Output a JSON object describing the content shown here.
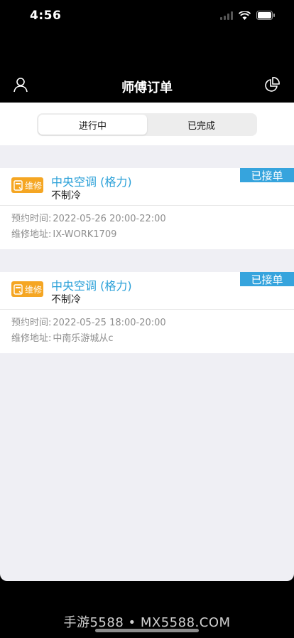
{
  "status_bar": {
    "time": "4:56"
  },
  "nav": {
    "title": "师傅订单"
  },
  "tabs": [
    {
      "label": "进行中",
      "active": true
    },
    {
      "label": "已完成",
      "active": false
    }
  ],
  "orders": [
    {
      "badge": "维修",
      "title": "中央空调 (格力)",
      "issue": "不制冷",
      "status": "已接单",
      "time_label": "预约时间:",
      "time_value": "2022-05-26 20:00-22:00",
      "address_label": "维修地址:",
      "address_value": "IX-WORK1709"
    },
    {
      "badge": "维修",
      "title": "中央空调 (格力)",
      "issue": "不制冷",
      "status": "已接单",
      "time_label": "预约时间:",
      "time_value": "2022-05-25 18:00-20:00",
      "address_label": "维修地址:",
      "address_value": "中南乐游城从c"
    }
  ],
  "watermark": "手游5588 • MX5588.COM",
  "colors": {
    "accent_blue": "#36a4dd",
    "title_blue": "#2aa0d8",
    "badge_orange": "#f5a623"
  }
}
